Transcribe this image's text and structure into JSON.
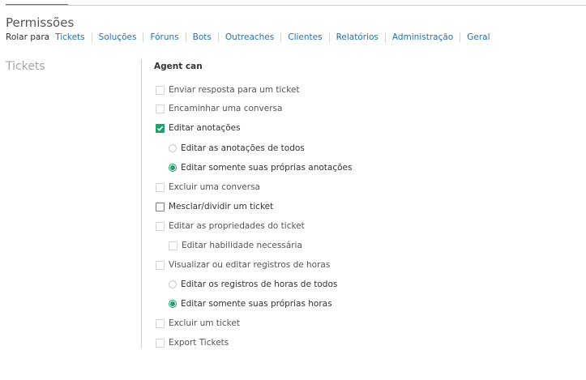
{
  "page": {
    "title": "Permissões"
  },
  "scroll_nav": {
    "label": "Rolar para",
    "links": [
      "Tickets",
      "Soluções",
      "Fóruns",
      "Bots",
      "Outreaches",
      "Clientes",
      "Relatórios",
      "Administração",
      "Geral"
    ]
  },
  "section": {
    "title": "Tickets",
    "group_heading": "Agent can"
  },
  "permissions": [
    {
      "label": "Enviar resposta para um ticket",
      "control": "checkbox",
      "checked": false,
      "disabled": true
    },
    {
      "label": "Encaminhar uma conversa",
      "control": "checkbox",
      "checked": false,
      "disabled": true
    },
    {
      "label": "Editar anotações",
      "control": "checkbox",
      "checked": true,
      "disabled": false
    },
    {
      "label": "Editar as anotações de todos",
      "control": "radio",
      "checked": false,
      "disabled": false
    },
    {
      "label": "Editar somente suas próprias anotações",
      "control": "radio",
      "checked": true,
      "disabled": false
    },
    {
      "label": "Excluir uma conversa",
      "control": "checkbox",
      "checked": false,
      "disabled": true
    },
    {
      "label": "Mesclar/dividir um ticket",
      "control": "checkbox",
      "checked": false,
      "disabled": false
    },
    {
      "label": "Editar as propriedades do ticket",
      "control": "checkbox",
      "checked": false,
      "disabled": true
    },
    {
      "label": "Editar habilidade necessária",
      "control": "checkbox",
      "checked": false,
      "disabled": true
    },
    {
      "label": "Visualizar ou editar registros de horas",
      "control": "checkbox",
      "checked": false,
      "disabled": true
    },
    {
      "label": "Editar os registros de horas de todos",
      "control": "radio",
      "checked": false,
      "disabled": false
    },
    {
      "label": "Editar somente suas próprias horas",
      "control": "radio",
      "checked": true,
      "disabled": false
    },
    {
      "label": "Excluir um ticket",
      "control": "checkbox",
      "checked": false,
      "disabled": true
    },
    {
      "label": "Export Tickets",
      "control": "checkbox",
      "checked": false,
      "disabled": true
    }
  ],
  "colors": {
    "accent": "#1aa36a",
    "link": "#1e72b8"
  }
}
